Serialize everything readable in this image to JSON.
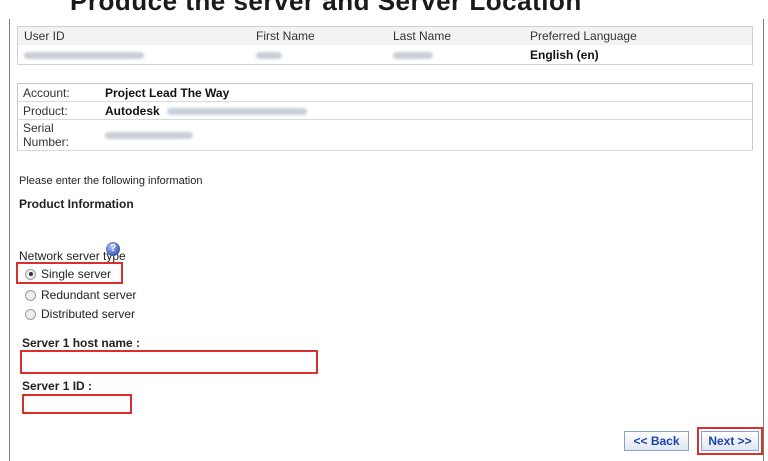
{
  "top_text": "Produce the server and Server Location",
  "user_table": {
    "headers": [
      "User ID",
      "First Name",
      "Last Name",
      "Preferred Language"
    ],
    "preferred_language": "English (en)"
  },
  "account_table": {
    "account_label": "Account:",
    "account_value": "Project Lead The Way",
    "product_label": "Product:",
    "product_value": "Autodesk",
    "serial_label": "Serial Number:"
  },
  "intro_text": "Please enter the following information",
  "section_title": "Product Information",
  "network": {
    "label": "Network server type",
    "options": [
      "Single server",
      "Redundant server",
      "Distributed server"
    ],
    "selected": "Single server"
  },
  "fields": {
    "host_label": "Server 1 host name :",
    "host_value": "",
    "id_label": "Server 1 ID :",
    "id_value": ""
  },
  "buttons": {
    "back": "<< Back",
    "next": "Next >>"
  },
  "colors": {
    "highlight": "#d9302c",
    "button_text": "#1b44a8"
  }
}
